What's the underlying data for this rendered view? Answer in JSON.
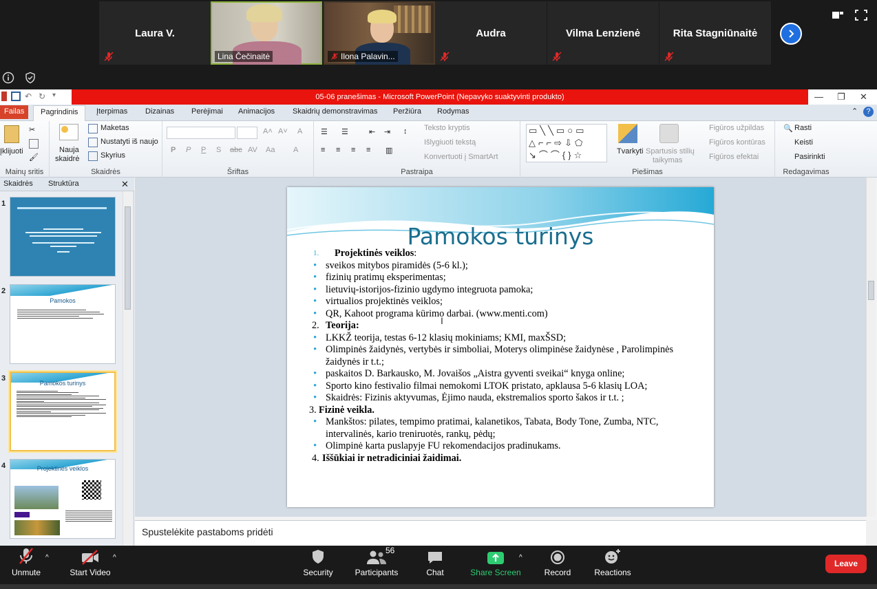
{
  "gallery": {
    "tiles": [
      {
        "name": "Laura V.",
        "kind": "name"
      },
      {
        "name": "Lina Čečinaitė",
        "kind": "video"
      },
      {
        "name": "Ilona Palavin...",
        "kind": "video"
      },
      {
        "name": "Audra",
        "kind": "name"
      },
      {
        "name": "Vilma Lenzienė",
        "kind": "name"
      },
      {
        "name": "Rita Stagniūnaitė",
        "kind": "name"
      }
    ]
  },
  "ppt": {
    "window_title": "05-06 pranešimas  -  Microsoft PowerPoint (Nepavyko suaktyvinti produkto)",
    "tabs": [
      "Failas",
      "Pagrindinis",
      "Įterpimas",
      "Dizainas",
      "Perėjimai",
      "Animacijos",
      "Skaidrių demonstravimas",
      "Peržiūra",
      "Rodymas"
    ],
    "ribbon": {
      "clipboard": {
        "paste": "Įklijuoti",
        "group": "Mainų sritis"
      },
      "slides": {
        "new_slide": "Nauja",
        "new_slide2": "skaidrė",
        "layout": "Maketas",
        "reset": "Nustatyti iš naujo",
        "section": "Skyrius",
        "group": "Skaidrės"
      },
      "font": {
        "group": "Šriftas"
      },
      "paragraph": {
        "text_direction": "Teksto kryptis",
        "align_text": "Išlygiuoti tekstą",
        "smartart": "Konvertuoti į SmartArt",
        "group": "Pastraipa"
      },
      "drawing": {
        "arrange": "Tvarkyti",
        "quick_styles": "Spartusis stilių",
        "quick_styles2": "taikymas",
        "fill": "Figūros užpildas",
        "outline": "Figūros kontūras",
        "effects": "Figūros efektai",
        "group": "Piešimas"
      },
      "editing": {
        "find": "Rasti",
        "replace": "Keisti",
        "select": "Pasirinkti",
        "group": "Redagavimas"
      }
    },
    "panel_tabs": {
      "slides": "Skaidrės",
      "outline": "Struktūra"
    },
    "thumbs": [
      {
        "num": "1",
        "title": ""
      },
      {
        "num": "2",
        "title": "Pamokos"
      },
      {
        "num": "3",
        "title": "Pamokos turinys"
      },
      {
        "num": "4",
        "title": "Projektinės veiklos"
      }
    ],
    "slide": {
      "title": "Pamokos turinys",
      "sections": {
        "s1": "Projektinės veiklos",
        "s1_items": [
          "sveikos mitybos piramidės (5-6 kl.);",
          "fizinių pratimų eksperimentas;",
          " lietuvių-istorijos-fizinio ugdymo integruota pamoka;",
          "virtualios projektinės veiklos;",
          "QR, Kahoot programa kūrimo darbai. (www.menti.com)"
        ],
        "s2": "Teorija:",
        "s2_items": [
          "LKKŽ teorija, testas 6-12 klasių mokiniams; KMI, maxŠSD;",
          "Olimpinės žaidynės, vertybės ir simboliai, Moterys olimpinėse žaidynėse , Parolimpinės žaidynės ir t.t.;",
          "paskaitos D. Barkausko, M. Jovaišos „Aistra gyventi sveikai“ knyga online;",
          "Sporto kino festivalio filmai nemokomi LTOK pristato, apklausa 5-6 klasių LOA;",
          "Skaidrės: Fizinis aktyvumas, Ėjimo nauda, ekstremalios sporto šakos ir t.t. ;"
        ],
        "s3": "Fizinė veikla.",
        "s3_items": [
          "Mankštos: pilates, tempimo pratimai, kalanetikos, Tabata, Body Tone, Zumba, NTC, intervalinės, kario treniruotės, rankų, pėdų;",
          "Olimpinė karta puslapyje FU rekomendacijos pradinukams."
        ],
        "s4": "Iššūkiai ir netradiciniai žaidimai."
      }
    },
    "notes_placeholder": "Spustelėkite pastaboms pridėti"
  },
  "zoom": {
    "unmute": "Unmute",
    "start_video": "Start Video",
    "security": "Security",
    "participants": "Participants",
    "participants_count": "56",
    "chat": "Chat",
    "share": "Share Screen",
    "record": "Record",
    "reactions": "Reactions",
    "leave": "Leave"
  }
}
